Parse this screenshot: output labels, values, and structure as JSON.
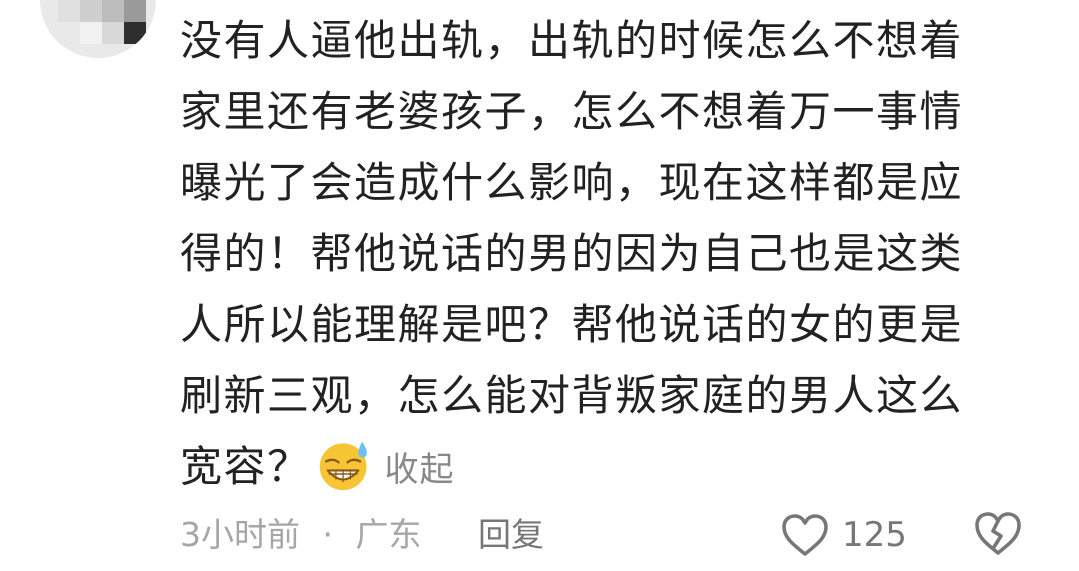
{
  "comment": {
    "lines": [
      "没有人逼他出轨，出轨的时候怎么不想着",
      "家里还有老婆孩子，怎么不想着万一事情",
      "曝光了会造成什么影响，现在这样都是应",
      "得的！帮他说话的男的因为自己也是这类",
      "人所以能理解是吧？帮他说话的女的更是",
      "刷新三观，怎么能对背叛家庭的男人这么",
      "宽容？"
    ],
    "emoji": "grinning-sweat-face",
    "collapse_label": "收起"
  },
  "meta": {
    "time": "3小时前",
    "separator": "·",
    "location": "广东",
    "reply_label": "回复"
  },
  "actions": {
    "like_icon": "heart-outline-icon",
    "like_count": "125",
    "dislike_icon": "broken-heart-icon"
  },
  "colors": {
    "text": "#222222",
    "secondary": "#a6a6a6",
    "action": "#777777",
    "emoji_face": "#f7c534",
    "emoji_sweat": "#6cc0f2"
  }
}
